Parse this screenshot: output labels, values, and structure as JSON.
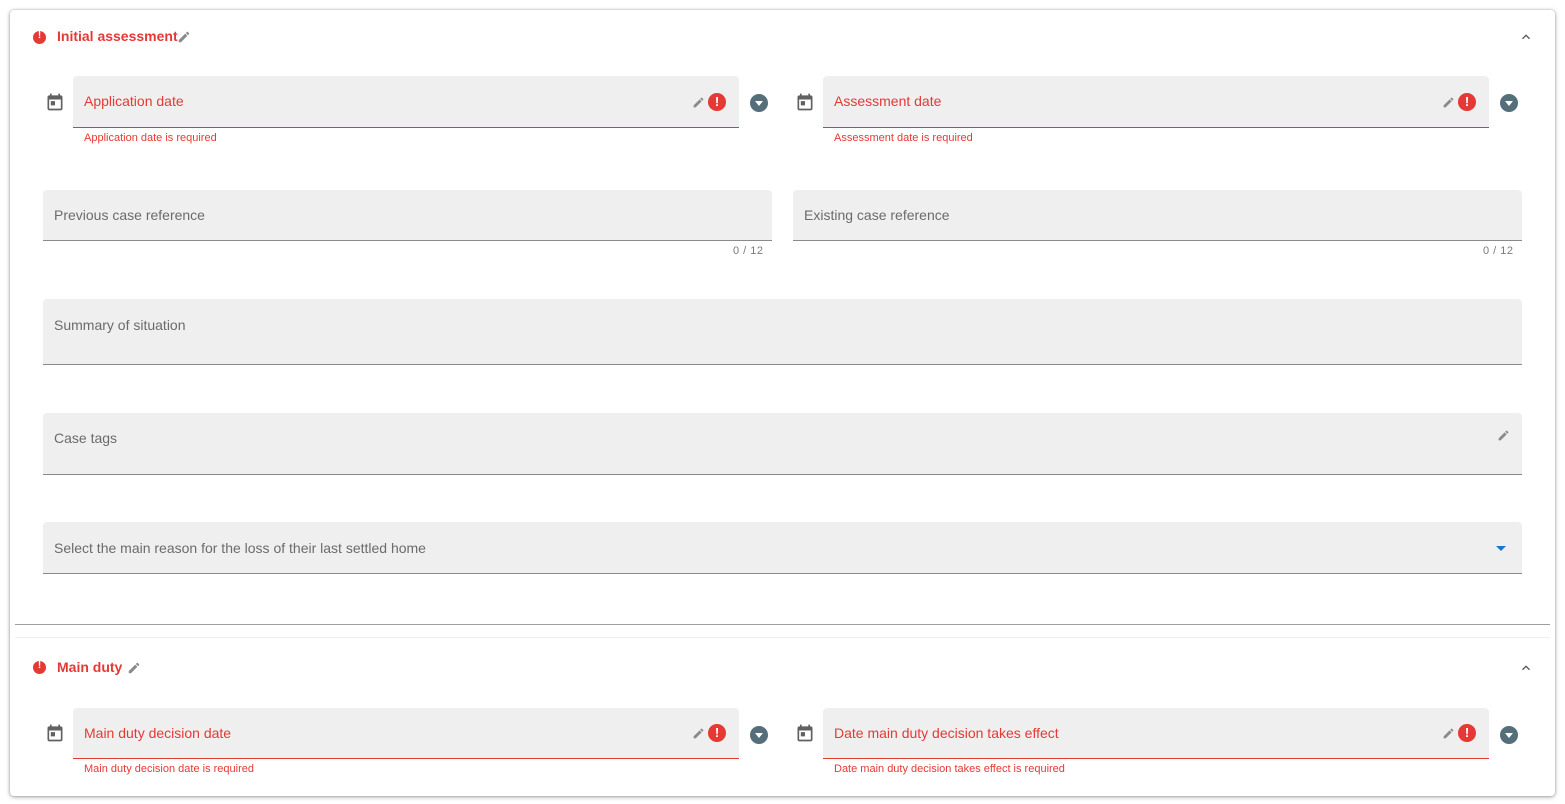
{
  "section1": {
    "title": "Initial assessment",
    "fields": {
      "application_date": {
        "label": "Application date",
        "error": "Application date is required"
      },
      "assessment_date": {
        "label": "Assessment date",
        "error": "Assessment date is required"
      },
      "previous_case_ref": {
        "label": "Previous case reference",
        "counter": "0 / 12"
      },
      "existing_case_ref": {
        "label": "Existing case reference",
        "counter": "0 / 12"
      },
      "summary": {
        "label": "Summary of situation"
      },
      "case_tags": {
        "label": "Case tags"
      },
      "main_reason": {
        "label": "Select the main reason for the loss of their last settled home"
      }
    }
  },
  "section2": {
    "title": "Main duty",
    "fields": {
      "decision_date": {
        "label": "Main duty decision date",
        "error": "Main duty decision date is required"
      },
      "effect_date": {
        "label": "Date main duty decision takes effect",
        "error": "Date main duty decision takes effect is required"
      }
    }
  },
  "icons": [
    "error-icon",
    "pencil-icon",
    "chevron-up-icon",
    "calendar-icon",
    "dropdown-circle-icon",
    "dropdown-arrow-icon"
  ],
  "colors": {
    "error": "#e53935",
    "field_bg": "#efefef",
    "dropdown_circle": "#546e7a",
    "select_arrow": "#1976d2"
  }
}
